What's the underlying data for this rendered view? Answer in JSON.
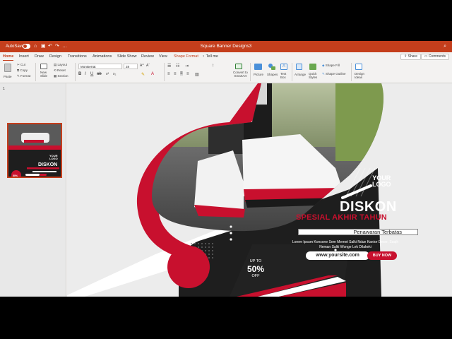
{
  "titlebar": {
    "autosave_label": "AutoSave",
    "toggle_state": "OFF",
    "document_title": "Square Banner Designs3",
    "search_icon": "search-icon"
  },
  "tabs": [
    {
      "label": "Home"
    },
    {
      "label": "Insert"
    },
    {
      "label": "Draw"
    },
    {
      "label": "Design"
    },
    {
      "label": "Transitions"
    },
    {
      "label": "Animations"
    },
    {
      "label": "Slide Show"
    },
    {
      "label": "Review"
    },
    {
      "label": "View"
    },
    {
      "label": "Shape Format"
    },
    {
      "label": "Tell me"
    }
  ],
  "share_label": "Share",
  "comments_label": "Comments",
  "ribbon": {
    "paste": "Paste",
    "cut": "Cut",
    "copy": "Copy",
    "format": "Format",
    "new_slide": "New\nSlide",
    "layout": "Layout",
    "reset": "Reset",
    "section": "Section",
    "font_name": "Montserrat",
    "font_size": "28",
    "convert_smartart": "Convert to\nSmartArt",
    "picture": "Picture",
    "shapes": "Shapes",
    "text_box": "Text\nBox",
    "arrange": "Arrange",
    "quick_styles": "Quick\nStyles",
    "shape_fill": "Shape Fill",
    "shape_outline": "Shape Outline",
    "design_ideas": "Design\nIdeas"
  },
  "thumbnail": {
    "slide_number": "1"
  },
  "slide": {
    "logo_line1": "YOUR",
    "logo_line2": "LOGO",
    "heading": "DISKON",
    "subheading": "SPESIAL AKHIR TAHUN",
    "tagline": "Penawaran Terbatas",
    "body": "Lorem Ipsum Konsone Sem Mernet Salki Ndue Kantor Dewe, Suqih Neman Salki Wonge Lek Dilakeki",
    "url": "www.yoursite.com",
    "cta": "BUY NOW",
    "badge_top": "UP TO",
    "badge_value": "50%",
    "badge_bottom": "OFF"
  },
  "colors": {
    "brand_red": "#c8102e",
    "ribbon_accent": "#c43e1c",
    "dark_panel": "#1e1e1e"
  }
}
